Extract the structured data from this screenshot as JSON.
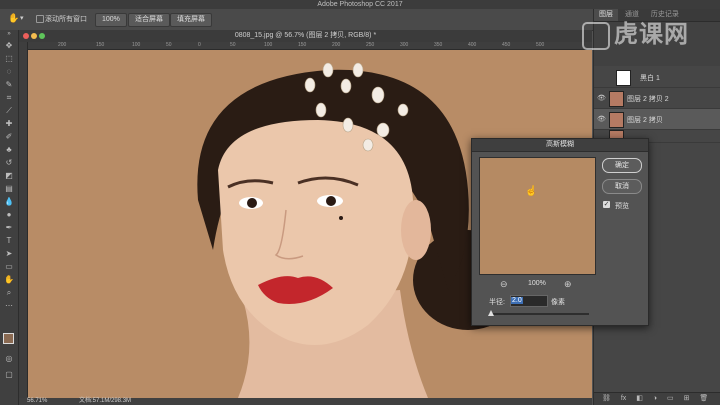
{
  "window": {
    "title": "Adobe Photoshop CC 2017"
  },
  "options_bar": {
    "scroll_all_windows": "滚动所有窗口",
    "zoom_100": "100%",
    "fit_screen": "适合屏幕",
    "fill_screen": "填充屏幕"
  },
  "document": {
    "tab_title": "0808_15.jpg @ 56.7% (图层 2 拷贝, RGB/8) *"
  },
  "ruler": {
    "ticks": [
      "200",
      "150",
      "100",
      "50",
      "0",
      "50",
      "100",
      "150",
      "200",
      "250",
      "300",
      "350",
      "400",
      "450",
      "500"
    ]
  },
  "status": {
    "zoom": "56.71%",
    "doc_size": "文档:57.1M/298.3M"
  },
  "panel": {
    "tabs": [
      "图层",
      "通道",
      "历史记录"
    ],
    "layers": [
      {
        "name": "黑白 1"
      },
      {
        "name": "图层 2 拷贝 2"
      },
      {
        "name": "图层 2 拷贝"
      }
    ]
  },
  "watermark": {
    "text": "虎课网"
  },
  "dialog": {
    "title": "高斯模糊",
    "ok_label": "确定",
    "cancel_label": "取消",
    "preview_label": "预览",
    "zoom_level": "100%",
    "radius_label": "半径:",
    "radius_value": "2.0",
    "radius_unit": "像素",
    "slider_fraction": 0.02
  },
  "colors": {
    "canvas_bg": "#b88c66",
    "skin": "#e8c4a8",
    "hair": "#2a1c14",
    "lips": "#c3262c"
  },
  "icons": [
    "hand-icon",
    "move-icon",
    "marquee-icon",
    "lasso-icon",
    "quick-select-icon",
    "crop-icon",
    "eyedropper-icon",
    "healing-icon",
    "brush-icon",
    "clone-stamp-icon",
    "history-brush-icon",
    "eraser-icon",
    "gradient-icon",
    "blur-icon",
    "dodge-icon",
    "pen-icon",
    "type-icon",
    "path-select-icon",
    "shape-icon",
    "zoom-icon",
    "eye-icon",
    "cursor-hand-icon"
  ]
}
